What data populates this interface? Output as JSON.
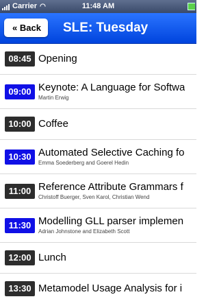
{
  "status_bar": {
    "carrier": "Carrier",
    "time": "11:48 AM"
  },
  "navbar": {
    "back_label": "« Back",
    "title": "SLE: Tuesday"
  },
  "sessions": [
    {
      "time": "08:45",
      "title": "Opening",
      "authors": "",
      "kind": "other"
    },
    {
      "time": "09:00",
      "title": "Keynote: A Language for Softwa",
      "authors": "Martin Erwig",
      "kind": "talk"
    },
    {
      "time": "10:00",
      "title": "Coffee",
      "authors": "",
      "kind": "other"
    },
    {
      "time": "10:30",
      "title": "Automated Selective Caching fo",
      "authors": "Emma Soederberg and Goerel Hedin",
      "kind": "talk"
    },
    {
      "time": "11:00",
      "title": "Reference Attribute Grammars f",
      "authors": "Christoff Buerger, Sven Karol, Christian Wend",
      "kind": "other"
    },
    {
      "time": "11:30",
      "title": "Modelling GLL parser implemen",
      "authors": "Adrian Johnstone and Elizabeth Scott",
      "kind": "talk"
    },
    {
      "time": "12:00",
      "title": "Lunch",
      "authors": "",
      "kind": "other"
    },
    {
      "time": "13:30",
      "title": "Metamodel Usage Analysis for i",
      "authors": "",
      "kind": "other"
    }
  ],
  "colors": {
    "talk_badge": "#1010e6",
    "other_badge": "#2d2d2d",
    "navbar": "#0a55f0"
  }
}
